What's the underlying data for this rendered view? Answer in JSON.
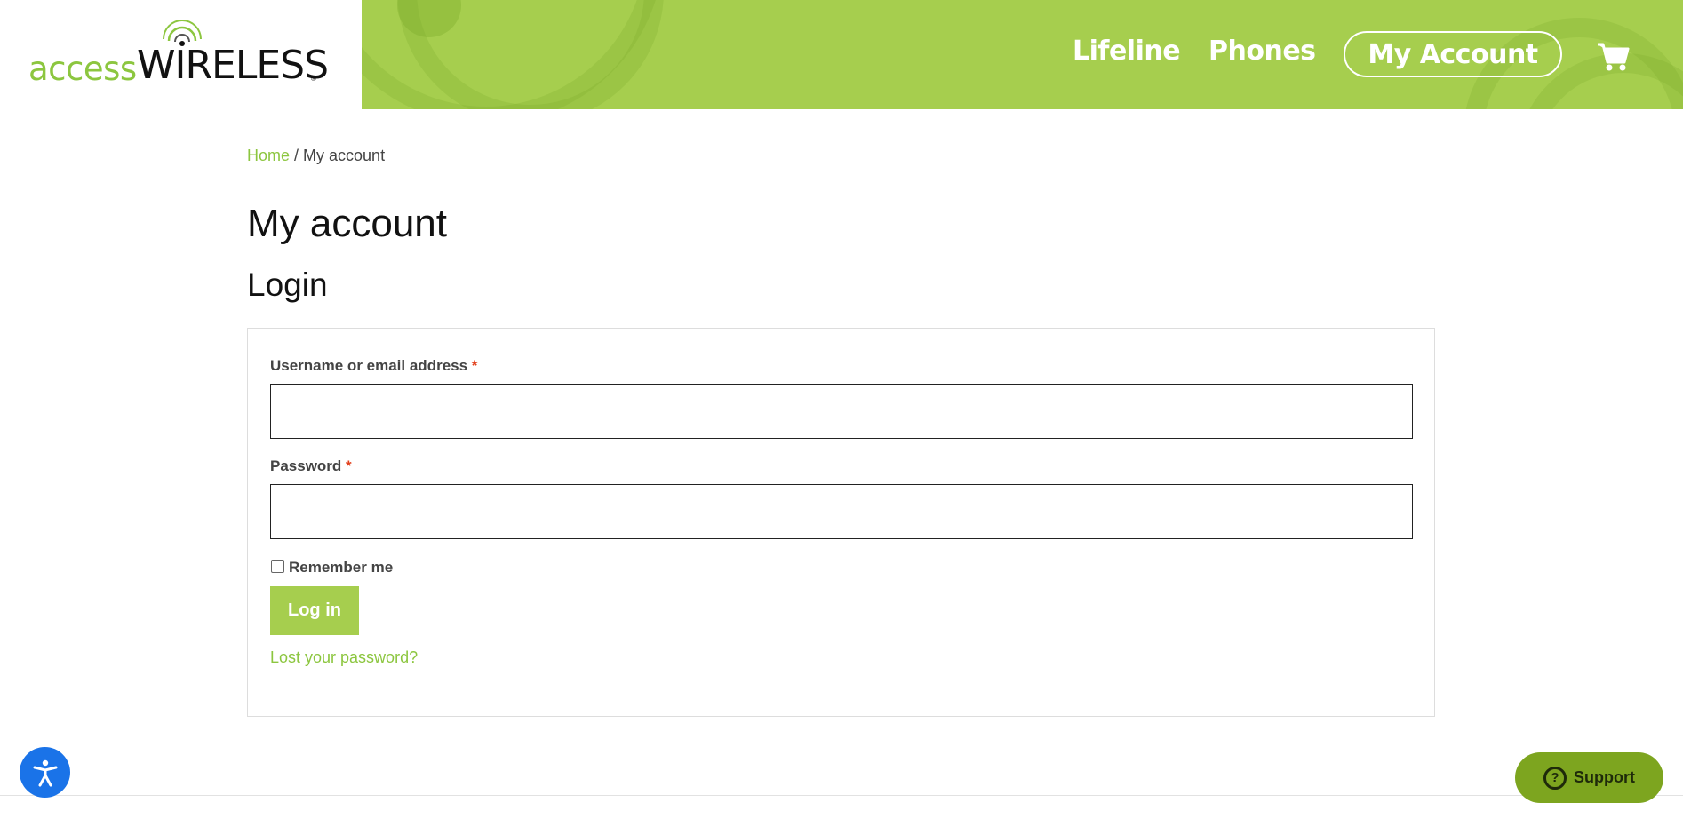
{
  "brand": {
    "logo_access": "access",
    "logo_wireless": "WIRELESS",
    "logo_reg": "®",
    "accent_color": "#a6ce4e",
    "link_color": "#8cc63f"
  },
  "nav": {
    "lifeline": "Lifeline",
    "phones": "Phones",
    "my_account": "My Account",
    "cart_icon": "cart-icon"
  },
  "breadcrumb": {
    "home": "Home",
    "separator": " / ",
    "current": "My account"
  },
  "page": {
    "title": "My account",
    "subtitle": "Login"
  },
  "form": {
    "username_label": "Username or email address",
    "password_label": "Password",
    "required_mark": "*",
    "username_value": "",
    "password_value": "",
    "remember_label": "Remember me",
    "remember_checked": false,
    "login_button": "Log in",
    "lost_password": "Lost your password?"
  },
  "widgets": {
    "accessibility_icon": "accessibility-icon",
    "support_label": "Support",
    "support_icon_glyph": "?"
  }
}
